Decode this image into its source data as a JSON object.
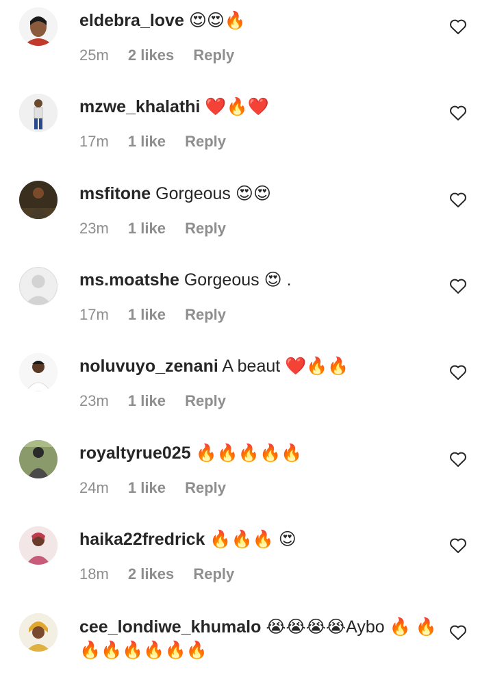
{
  "comments": [
    {
      "username": "eldebra_love",
      "text": "😍😍🔥",
      "time": "25m",
      "likes": "2 likes",
      "reply": "Reply",
      "avatar_color": "#c0392b"
    },
    {
      "username": "mzwe_khalathi",
      "text": "❤️🔥❤️",
      "time": "17m",
      "likes": "1 like",
      "reply": "Reply",
      "avatar_color": "#e8e8e8"
    },
    {
      "username": "msfitone",
      "text": "Gorgeous 😍😍",
      "time": "23m",
      "likes": "1 like",
      "reply": "Reply",
      "avatar_color": "#5a4a2a"
    },
    {
      "username": "ms.moatshe",
      "text": "Gorgeous 😍 .",
      "time": "17m",
      "likes": "1 like",
      "reply": "Reply",
      "avatar_color": "#dbdbdb"
    },
    {
      "username": "noluvuyo_zenani",
      "text": "A beaut ❤️🔥🔥",
      "time": "23m",
      "likes": "1 like",
      "reply": "Reply",
      "avatar_color": "#f2f2f2"
    },
    {
      "username": "royaltyrue025",
      "text": "🔥🔥🔥🔥🔥",
      "time": "24m",
      "likes": "1 like",
      "reply": "Reply",
      "avatar_color": "#6b7a4a"
    },
    {
      "username": "haika22fredrick",
      "text": "🔥🔥🔥 😍",
      "time": "18m",
      "likes": "2 likes",
      "reply": "Reply",
      "avatar_color": "#c85a7a"
    },
    {
      "username": "cee_londiwe_khumalo",
      "text": "😭😭😭😭Aybo 🔥 🔥🔥🔥🔥🔥🔥🔥",
      "time": "",
      "likes": "",
      "reply": "",
      "avatar_color": "#e0b040"
    }
  ]
}
